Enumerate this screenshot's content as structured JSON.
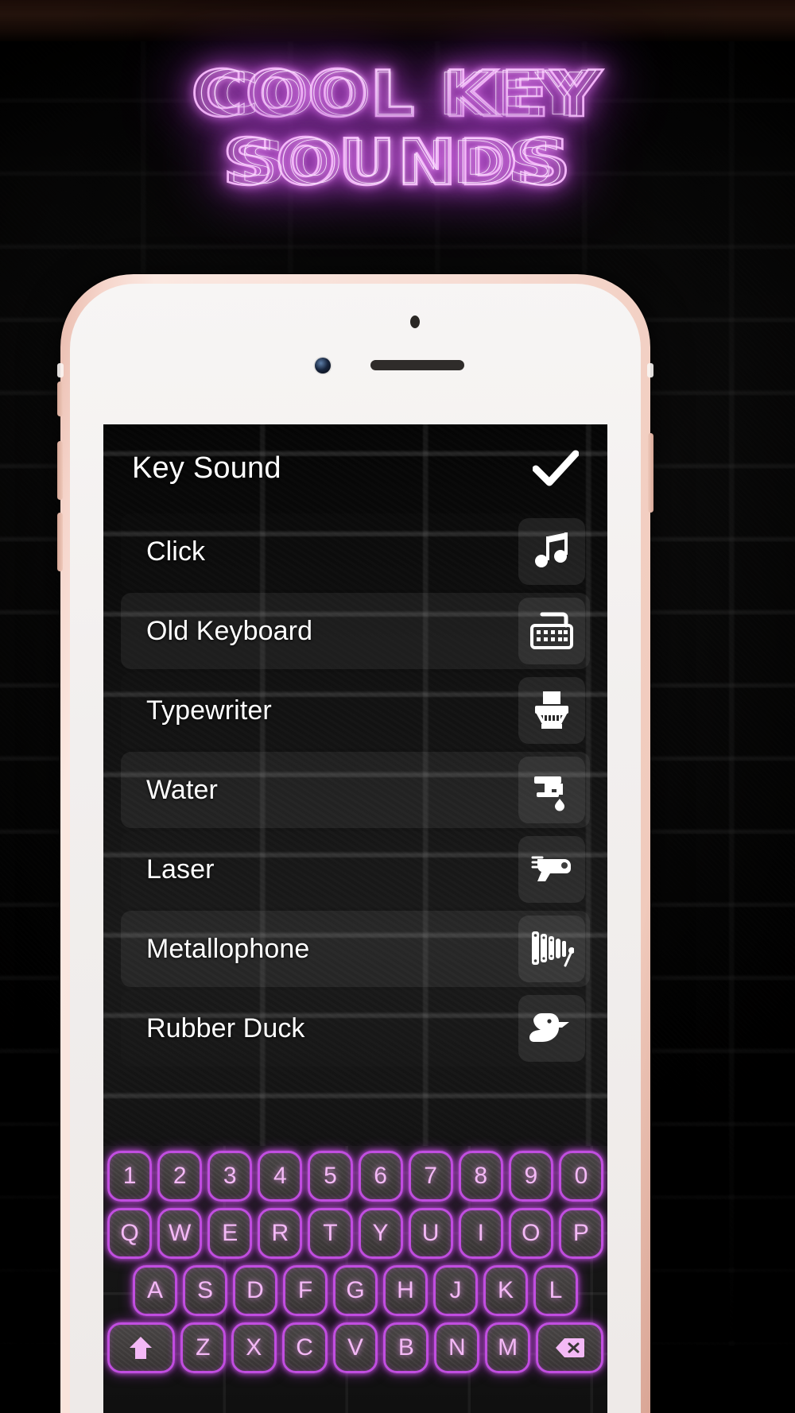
{
  "promo": {
    "headline_line1": "COOL KEY",
    "headline_line2": "SOUNDS",
    "neon_color": "#e37ff0"
  },
  "device": {
    "frame_color": "#f0cabc",
    "camera_icon": "front-camera",
    "sensor_icon": "proximity-sensor",
    "speaker_icon": "earpiece-speaker"
  },
  "app": {
    "header": {
      "title": "Key Sound",
      "confirm_icon": "checkmark-icon",
      "confirm_color": "#ffffff"
    },
    "sounds": [
      {
        "label": "Click",
        "icon": "music-note-icon",
        "selected": false
      },
      {
        "label": "Old Keyboard",
        "icon": "keyboard-icon",
        "selected": true
      },
      {
        "label": "Typewriter",
        "icon": "typewriter-icon",
        "selected": false
      },
      {
        "label": "Water",
        "icon": "faucet-icon",
        "selected": false
      },
      {
        "label": "Laser",
        "icon": "ray-gun-icon",
        "selected": false
      },
      {
        "label": "Metallophone",
        "icon": "metallophone-icon",
        "selected": false
      },
      {
        "label": "Rubber Duck",
        "icon": "rubber-duck-icon",
        "selected": false
      }
    ]
  },
  "keyboard": {
    "theme_color": "#c14ee0",
    "key_text_color": "#f4b9f6",
    "rows": [
      {
        "name": "number-row",
        "keys": [
          "1",
          "2",
          "3",
          "4",
          "5",
          "6",
          "7",
          "8",
          "9",
          "0"
        ]
      },
      {
        "name": "top-letter-row",
        "keys": [
          "Q",
          "W",
          "E",
          "R",
          "T",
          "Y",
          "U",
          "I",
          "O",
          "P"
        ]
      },
      {
        "name": "home-letter-row",
        "keys": [
          "A",
          "S",
          "D",
          "F",
          "G",
          "H",
          "J",
          "K",
          "L"
        ]
      },
      {
        "name": "bottom-letter-row",
        "keys": [
          "Z",
          "X",
          "C",
          "V",
          "B",
          "N",
          "M"
        ]
      }
    ],
    "shift_icon": "shift-arrow-icon",
    "backspace_icon": "backspace-icon"
  }
}
